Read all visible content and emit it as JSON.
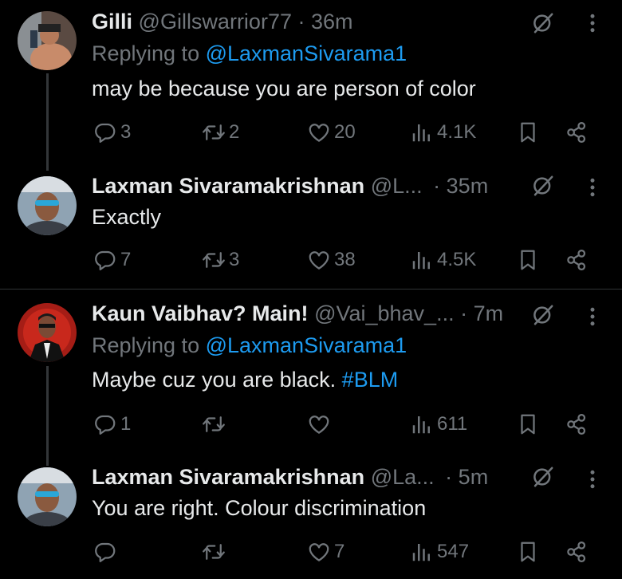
{
  "colors": {
    "background": "#000000",
    "text": "#e7e9ea",
    "muted": "#71767b",
    "link": "#1d9bf0",
    "divider": "#2f3336"
  },
  "tweets": [
    {
      "name": "Gilli",
      "handle": "@Gillswarrior77",
      "sep": "·",
      "time": "36m",
      "replying_label": "Replying to",
      "replying_to": "@LaxmanSivarama1",
      "text": "may be because you are person of color",
      "replies": "3",
      "retweets": "2",
      "likes": "20",
      "views": "4.1K"
    },
    {
      "name": "Laxman Sivaramakrishnan",
      "handle": "@L...",
      "sep": "·",
      "time": "35m",
      "text": "Exactly",
      "replies": "7",
      "retweets": "3",
      "likes": "38",
      "views": "4.5K"
    },
    {
      "name": "Kaun Vaibhav? Main!",
      "handle": "@Vai_bhav_...",
      "sep": "·",
      "time": "7m",
      "replying_label": "Replying to",
      "replying_to": "@LaxmanSivarama1",
      "text": "Maybe cuz you are black.",
      "hashtag": "#BLM",
      "replies": "1",
      "retweets": "",
      "likes": "",
      "views": "611"
    },
    {
      "name": "Laxman Sivaramakrishnan",
      "handle": "@La...",
      "sep": "·",
      "time": "5m",
      "text": "You are right. Colour discrimination",
      "replies": "",
      "retweets": "",
      "likes": "7",
      "views": "547"
    }
  ],
  "icons": [
    "reply-icon",
    "retweet-icon",
    "like-icon",
    "views-icon",
    "bookmark-icon",
    "share-icon",
    "mute-icon",
    "more-icon"
  ]
}
